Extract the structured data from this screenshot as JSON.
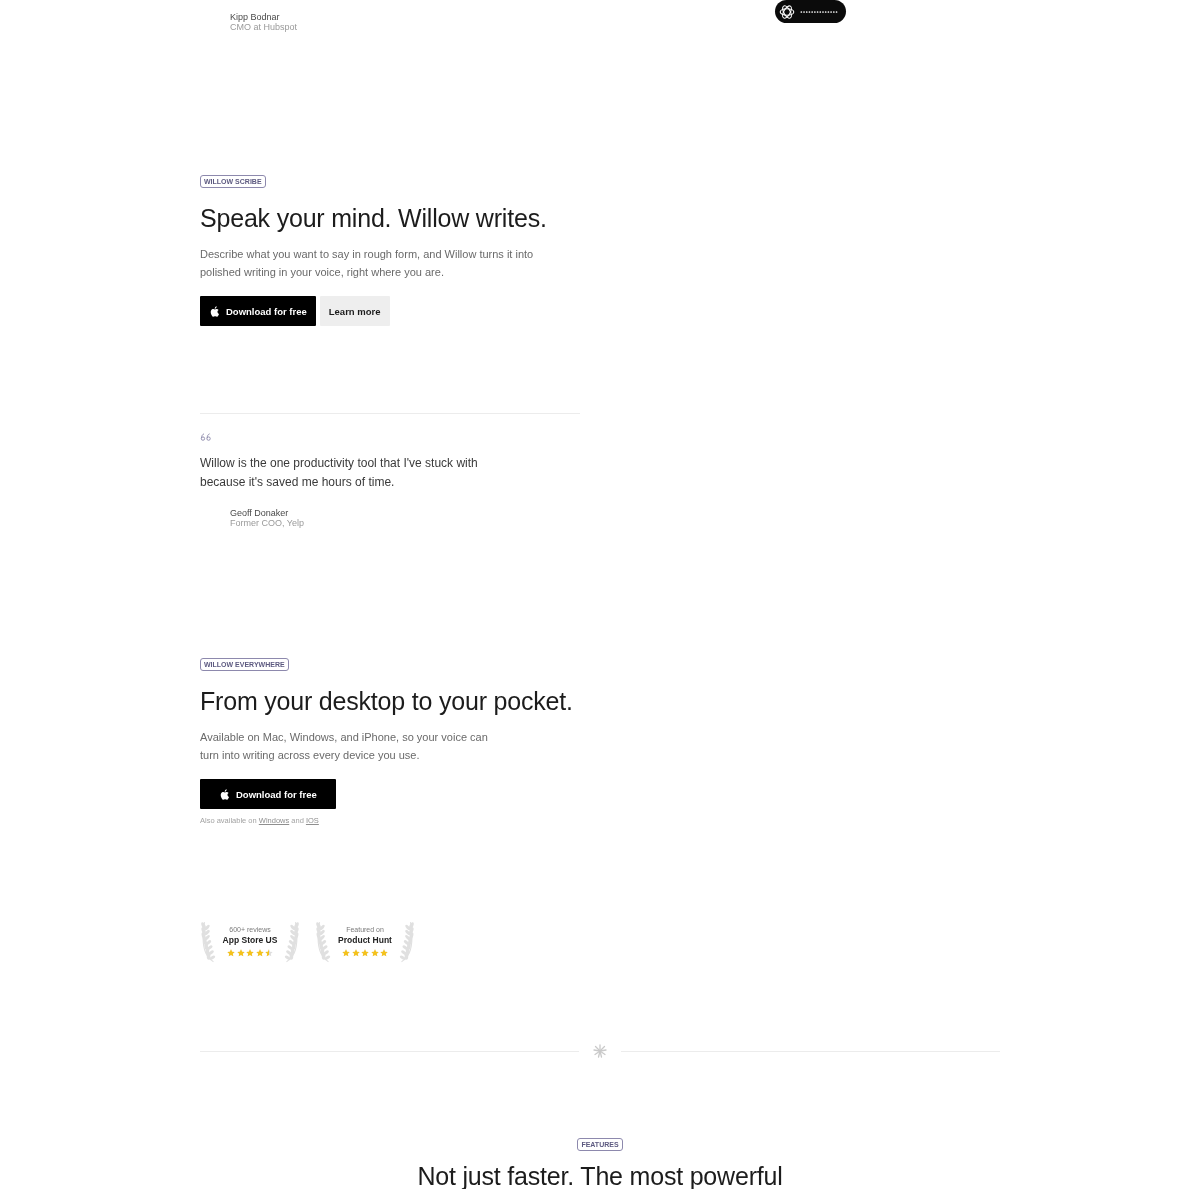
{
  "top_testimonial": {
    "name": "Kipp Bodnar",
    "role": "CMO at Hubspot"
  },
  "scribe": {
    "badge": "WILLOW SCRIBE",
    "heading": "Speak your mind. Willow writes.",
    "description": "Describe what you want to say in rough form, and Willow turns it into polished writing in your voice, right where you are.",
    "buttons": [
      {
        "kind": "primary",
        "label": "Download for free"
      },
      {
        "kind": "secondary",
        "label": "Learn more"
      }
    ]
  },
  "quote": {
    "text": "Willow is the one productivity tool that I've stuck with because it's saved me hours of time.",
    "name": "Geoff Donaker",
    "role": "Former COO, Yelp"
  },
  "everywhere": {
    "badge": "WILLOW EVERYWHERE",
    "heading": "From your desktop to your pocket.",
    "description": "Available on Mac, Windows, and iPhone, so your voice can turn into writing across every device you use.",
    "buttons": [
      {
        "kind": "primary",
        "label": "Download for free"
      }
    ],
    "availability": {
      "prefix": "Also available on",
      "links": [
        "Windows",
        "IOS"
      ],
      "joiner": "and"
    }
  },
  "awards": [
    {
      "caption": "600+ reviews",
      "title": "App Store US",
      "stars": 4.5
    },
    {
      "caption": "Featured on",
      "title": "Product Hunt",
      "stars": 5
    }
  ],
  "features": {
    "badge": "FEATURES",
    "heading": "Not just faster. The most powerful"
  }
}
